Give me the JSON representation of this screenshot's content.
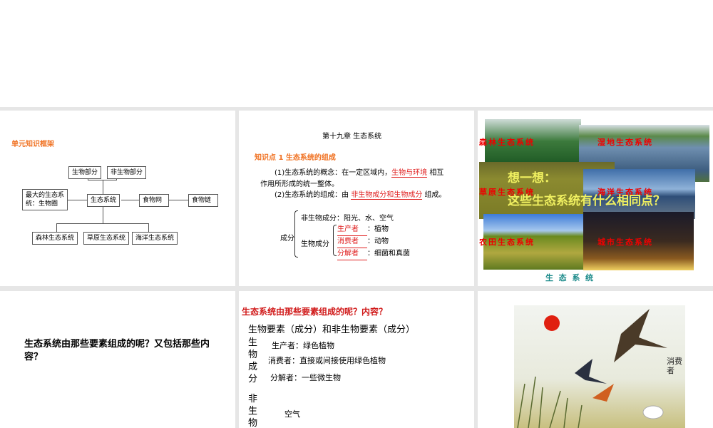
{
  "slide1": {
    "title": "单元知识框架",
    "boxes": {
      "bio": "生物部分",
      "nonbio": "非生物部分",
      "biggest": "最大的生态系统：生物圈",
      "eco": "生态系统",
      "web": "食物网",
      "chain": "食物链",
      "forest": "森林生态系统",
      "grass": "草原生态系统",
      "ocean": "海洋生态系统"
    }
  },
  "slide2": {
    "chapter": "第十九章  生态系统",
    "point": "知识点 1    生态系统的组成",
    "p1a": "(1)生态系统的概念：在一定区域内，",
    "p1b": "生物与环境",
    "p1c": "相互",
    "p1d": "作用所形成的统一整体。",
    "p2a": "(2)生态系统的组成：由",
    "p2b": "非生物成分和生物成分",
    "p2c": "组成。",
    "comp": "成分",
    "nonbio": "非生物成分：阳光、水、空气",
    "bio": "生物成分",
    "roles": [
      {
        "name": "生产者",
        "desc": "：植物"
      },
      {
        "name": "消费者",
        "desc": "：动物"
      },
      {
        "name": "分解者",
        "desc": "：细菌和真菌"
      }
    ]
  },
  "slide3": {
    "labels": [
      "森林生态系统",
      "湿地生态系统",
      "草原生态系统",
      "海洋生态系统",
      "农田生态系统",
      "城市生态系统"
    ],
    "think": "想一想：",
    "question": "这些生态系统有什么相同点？",
    "footer": "生  态  系  统"
  },
  "slide4": {
    "text": "生态系统由那些要素组成的呢？又包括那些内容？"
  },
  "slide5": {
    "title": "生态系统由那些要素组成的呢？内容？",
    "sub": "生物要素（成分）和非生物要素（成分）",
    "bio_v": "生物成分",
    "nonbio_v": "非生物",
    "producer": "生产者：绿色植物",
    "consumer": "消费者：直接或间接使用绿色植物",
    "decomposer": "分解者：一些微生物",
    "air": "空气"
  },
  "slide6": {
    "label": "消费者"
  }
}
